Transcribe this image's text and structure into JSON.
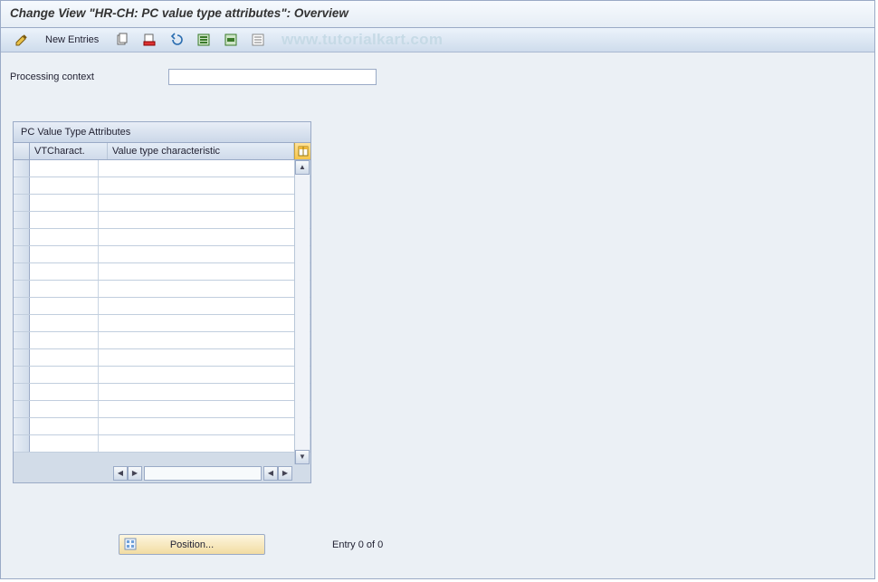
{
  "title": "Change View \"HR-CH: PC value type attributes\": Overview",
  "toolbar": {
    "new_entries_label": "New Entries"
  },
  "watermark": "www.tutorialkart.com",
  "form": {
    "processing_context_label": "Processing context",
    "processing_context_value": ""
  },
  "table": {
    "title": "PC Value Type Attributes",
    "columns": {
      "col1": "VTCharact.",
      "col2": "Value type characteristic"
    },
    "row_count": 17
  },
  "footer": {
    "position_label": "Position...",
    "entry_label": "Entry 0 of 0"
  }
}
